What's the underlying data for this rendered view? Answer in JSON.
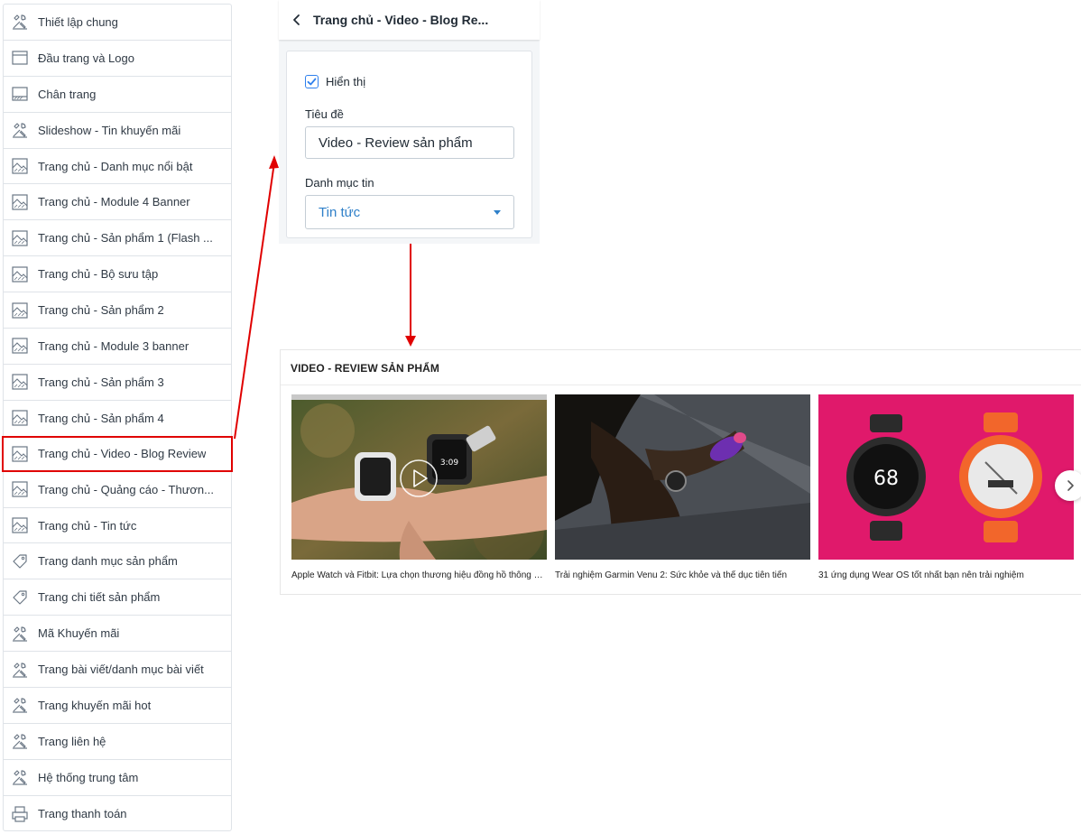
{
  "sidebar": {
    "items": [
      {
        "label": "Thiết lập chung",
        "icon": "tools-icon"
      },
      {
        "label": "Đầu trang và Logo",
        "icon": "header-layout-icon"
      },
      {
        "label": "Chân trang",
        "icon": "footer-layout-icon"
      },
      {
        "label": "Slideshow - Tin khuyến mãi",
        "icon": "tools-icon"
      },
      {
        "label": "Trang chủ - Danh mục nổi bật",
        "icon": "home-section-icon"
      },
      {
        "label": "Trang chủ - Module 4 Banner",
        "icon": "home-section-icon"
      },
      {
        "label": "Trang chủ - Sản phẩm 1 (Flash ...",
        "icon": "home-section-icon"
      },
      {
        "label": "Trang chủ - Bộ sưu tập",
        "icon": "home-section-icon"
      },
      {
        "label": "Trang chủ - Sản phẩm 2",
        "icon": "home-section-icon"
      },
      {
        "label": "Trang chủ - Module 3 banner",
        "icon": "home-section-icon"
      },
      {
        "label": "Trang chủ - Sản phẩm 3",
        "icon": "home-section-icon"
      },
      {
        "label": "Trang chủ - Sản phẩm 4",
        "icon": "home-section-icon"
      },
      {
        "label": "Trang chủ - Video - Blog Review",
        "icon": "home-section-icon",
        "active": true
      },
      {
        "label": "Trang chủ - Quảng cáo - Thươn...",
        "icon": "home-section-icon"
      },
      {
        "label": "Trang chủ - Tin tức",
        "icon": "home-section-icon"
      },
      {
        "label": "Trang danh mục sản phẩm",
        "icon": "tag-icon"
      },
      {
        "label": "Trang chi tiết sản phẩm",
        "icon": "tag-icon"
      },
      {
        "label": "Mã Khuyến mãi",
        "icon": "tools-icon"
      },
      {
        "label": "Trang bài viết/danh mục bài viết",
        "icon": "tools-icon"
      },
      {
        "label": "Trang khuyến mãi hot",
        "icon": "tools-icon"
      },
      {
        "label": "Trang liên hệ",
        "icon": "tools-icon"
      },
      {
        "label": "Hệ thống trung tâm",
        "icon": "tools-icon"
      },
      {
        "label": "Trang thanh toán",
        "icon": "printer-icon"
      }
    ]
  },
  "panel": {
    "title": "Trang chủ - Video - Blog Re...",
    "show_label": "Hiển thị",
    "show_checked": true,
    "title_label": "Tiêu đề",
    "title_value": "Video - Review sản phẩm",
    "category_label": "Danh mục tin",
    "category_value": "Tin tức"
  },
  "preview": {
    "heading": "VIDEO - REVIEW SẢN PHẨM",
    "videos": [
      {
        "title": "Apple Watch và Fitbit: Lựa chọn thương hiệu đồng hồ thông minh nào"
      },
      {
        "title": "Trải nghiệm Garmin Venu 2: Sức khỏe và thể dục tiên tiến"
      },
      {
        "title": "31 ứng dụng Wear OS tốt nhất bạn nên trải nghiệm"
      }
    ],
    "watch_readout": "68"
  },
  "colors": {
    "highlight": "#e00000",
    "accent_blue": "#2f80ed",
    "magenta_bg": "#e0196b"
  }
}
